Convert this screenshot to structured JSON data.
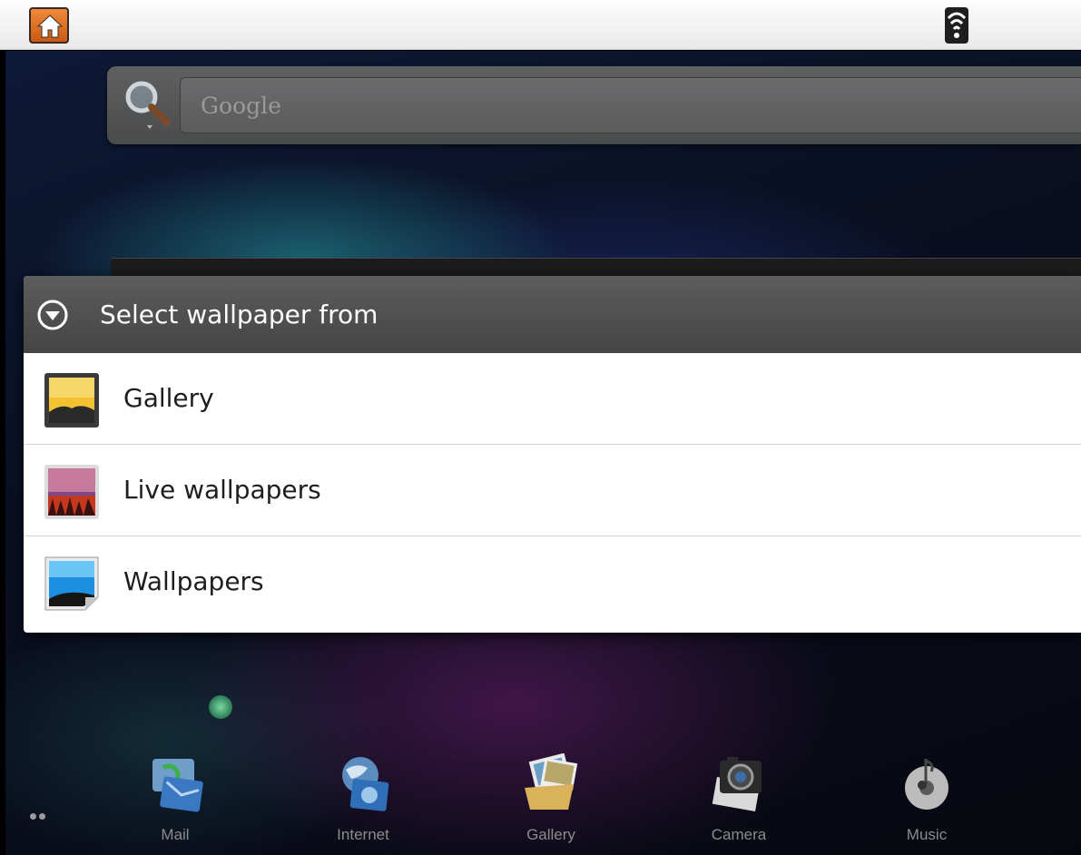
{
  "search": {
    "placeholder": "Google"
  },
  "dialog": {
    "title": "Select wallpaper from",
    "options": [
      {
        "label": "Gallery",
        "icon": "gallery-icon"
      },
      {
        "label": "Live wallpapers",
        "icon": "live-wallpapers-icon"
      },
      {
        "label": "Wallpapers",
        "icon": "wallpapers-icon"
      }
    ]
  },
  "dock": {
    "items": [
      {
        "label": "Mail",
        "icon": "mail-icon"
      },
      {
        "label": "Internet",
        "icon": "internet-icon"
      },
      {
        "label": "Gallery",
        "icon": "gallery-app-icon"
      },
      {
        "label": "Camera",
        "icon": "camera-icon"
      },
      {
        "label": "Music",
        "icon": "music-icon"
      }
    ]
  },
  "colors": {
    "dialog_header": "#4f4f4f",
    "dialog_body": "#ffffff",
    "statusbar": "#f2f2f2"
  }
}
